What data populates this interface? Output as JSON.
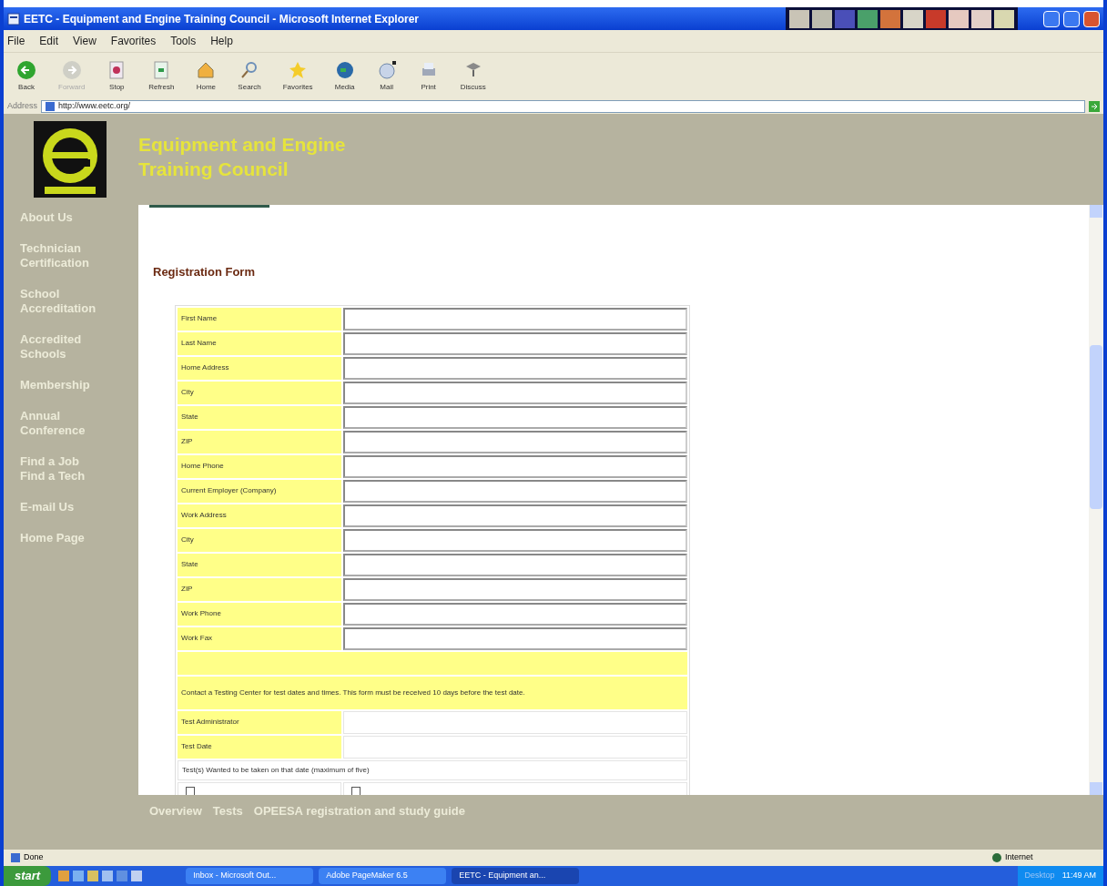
{
  "window": {
    "title": "EETC - Equipment and Engine Training Council - Microsoft Internet Explorer"
  },
  "menu": [
    "File",
    "Edit",
    "View",
    "Favorites",
    "Tools",
    "Help"
  ],
  "toolbar": [
    {
      "label": "Back",
      "kind": "back"
    },
    {
      "label": "Forward",
      "kind": "forward"
    },
    {
      "label": "Stop",
      "kind": "stop"
    },
    {
      "label": "Refresh",
      "kind": "refresh"
    },
    {
      "label": "Home",
      "kind": "home"
    },
    {
      "label": "Search",
      "kind": "search"
    },
    {
      "label": "Favorites",
      "kind": "favorites"
    },
    {
      "label": "Media",
      "kind": "media"
    },
    {
      "label": "Mail",
      "kind": "mail"
    },
    {
      "label": "Print",
      "kind": "print"
    },
    {
      "label": "Discuss",
      "kind": "discuss"
    }
  ],
  "address": {
    "label": "Address",
    "url": "http://www.eetc.org/"
  },
  "site": {
    "title_lines": [
      "Equipment and Engine",
      "Training Council"
    ]
  },
  "sidebar": [
    [
      "About Us"
    ],
    [
      "Technician",
      "Certification"
    ],
    [
      "School",
      "Accreditation"
    ],
    [
      "Accredited",
      "Schools"
    ],
    [
      "Membership"
    ],
    [
      "Annual",
      "Conference"
    ],
    [
      "Find a Job",
      "Find a Tech"
    ],
    [
      "E-mail Us"
    ],
    [
      "Home Page"
    ]
  ],
  "form": {
    "heading": "Registration Form",
    "fields": [
      "First Name",
      "Last Name",
      "Home Address",
      "City",
      "State",
      "ZIP",
      "Home Phone",
      "Current Employer (Company)",
      "Work Address",
      "City",
      "State",
      "ZIP",
      "Work Phone",
      "Work Fax"
    ],
    "notice": "Contact a Testing Center for test dates and times. This form must be received 10 days before the test date.",
    "extra_fields": [
      "Test Administrator",
      "Test Date"
    ],
    "tests_label": "Test(s) Wanted to be taken on that date (maximum of five)",
    "checkboxes": [
      {
        "checked": false
      },
      {
        "checked": false
      }
    ]
  },
  "footer_links": [
    "Overview",
    "Tests",
    "OPEESA registration and study guide"
  ],
  "status_bar": {
    "text": "Done",
    "zone": "Internet"
  },
  "taskbar": {
    "start": "start",
    "tasks": [
      {
        "label": "Inbox - Microsoft Out...",
        "selected": false
      },
      {
        "label": "Adobe PageMaker 6.5",
        "selected": false
      },
      {
        "label": "EETC - Equipment an...",
        "selected": true
      }
    ],
    "tray_label": "Desktop",
    "clock": "11:49 AM"
  }
}
